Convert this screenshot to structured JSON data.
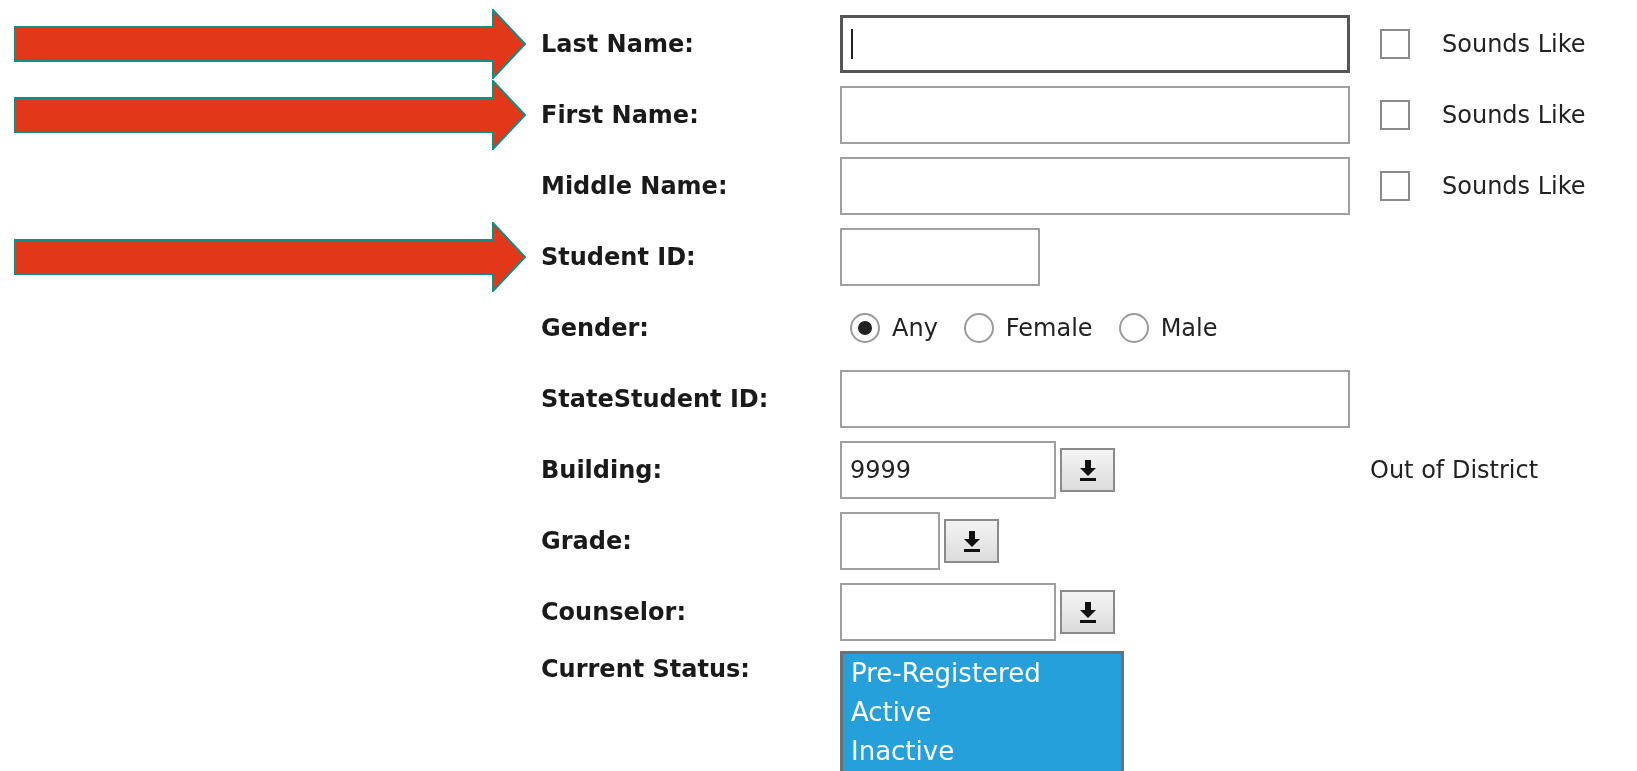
{
  "rows": [
    {
      "kind": "text",
      "label": "Last Name:",
      "arrow": true,
      "field": {
        "focused": true
      },
      "sounds_like": {
        "label": "Sounds Like",
        "checked": false
      }
    },
    {
      "kind": "text",
      "label": "First Name:",
      "arrow": true,
      "field": {
        "focused": false
      },
      "sounds_like": {
        "label": "Sounds Like",
        "checked": false
      }
    },
    {
      "kind": "text",
      "label": "Middle Name:",
      "arrow": false,
      "field": {
        "focused": false
      },
      "sounds_like": {
        "label": "Sounds Like",
        "checked": false
      }
    },
    {
      "kind": "text",
      "label": "Student ID:",
      "arrow": true,
      "field": {
        "focused": false
      }
    },
    {
      "kind": "radio",
      "label": "Gender:",
      "arrow": false,
      "options": [
        {
          "label": "Any",
          "selected": true
        },
        {
          "label": "Female",
          "selected": false
        },
        {
          "label": "Male",
          "selected": false
        }
      ]
    },
    {
      "kind": "text",
      "label": "StateStudent ID:",
      "arrow": false,
      "field": {
        "focused": false
      }
    },
    {
      "kind": "select",
      "label": "Building:",
      "arrow": false,
      "field": {
        "value": "9999"
      },
      "note": "Out of District"
    },
    {
      "kind": "select",
      "label": "Grade:",
      "arrow": false,
      "field": {}
    },
    {
      "kind": "select",
      "label": "Counselor:",
      "arrow": false,
      "field": {}
    },
    {
      "kind": "listbox",
      "label": "Current Status:",
      "arrow": false,
      "items": [
        {
          "label": "Pre-Registered",
          "selected": true
        },
        {
          "label": "Active",
          "selected": true
        },
        {
          "label": "Inactive",
          "selected": true
        }
      ]
    }
  ]
}
